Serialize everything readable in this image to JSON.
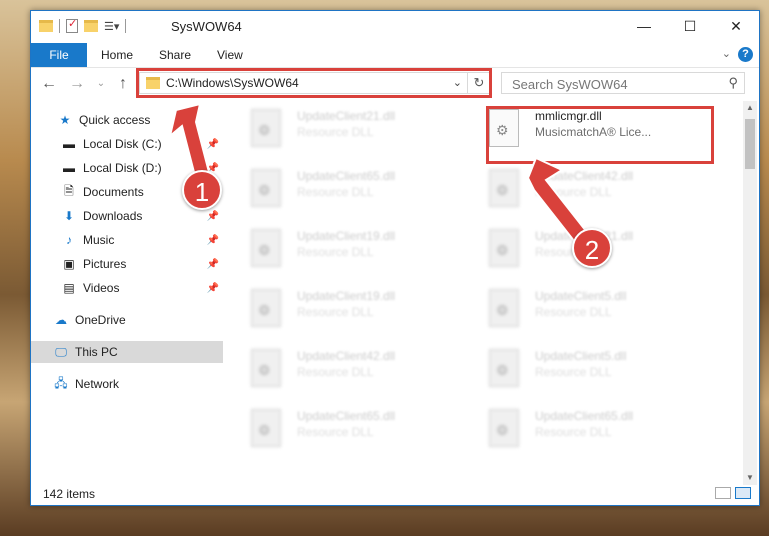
{
  "window": {
    "title": "SysWOW64"
  },
  "ribbon": {
    "tabs": [
      "File",
      "Home",
      "Share",
      "View"
    ]
  },
  "address": {
    "path": "C:\\Windows\\SysWOW64"
  },
  "search": {
    "placeholder": "Search SysWOW64"
  },
  "sidebar": {
    "items": [
      {
        "label": "Quick access",
        "icon": "star-icon",
        "pinned": false
      },
      {
        "label": "Local Disk (C:)",
        "icon": "drive-icon",
        "pinned": true
      },
      {
        "label": "Local Disk (D:)",
        "icon": "drive-icon",
        "pinned": true
      },
      {
        "label": "Documents",
        "icon": "documents-icon",
        "pinned": true
      },
      {
        "label": "Downloads",
        "icon": "download-icon",
        "pinned": true
      },
      {
        "label": "Music",
        "icon": "music-icon",
        "pinned": true
      },
      {
        "label": "Pictures",
        "icon": "pictures-icon",
        "pinned": true
      },
      {
        "label": "Videos",
        "icon": "videos-icon",
        "pinned": true
      },
      {
        "label": "OneDrive",
        "icon": "cloud-icon",
        "pinned": false
      },
      {
        "label": "This PC",
        "icon": "computer-icon",
        "pinned": false
      },
      {
        "label": "Network",
        "icon": "network-icon",
        "pinned": false
      }
    ]
  },
  "files": [
    {
      "name": "UpdateClient21.dll",
      "desc": "Resource DLL"
    },
    {
      "name": "mmlicmgr.dll",
      "desc": "MusicmatchA® Lice..."
    },
    {
      "name": "UpdateClient65.dll",
      "desc": "Resource DLL"
    },
    {
      "name": "UpdateClient42.dll",
      "desc": "Resource DLL"
    },
    {
      "name": "UpdateClient19.dll",
      "desc": "Resource DLL"
    },
    {
      "name": "UpdateClient21.dll",
      "desc": "Resource DLL"
    },
    {
      "name": "UpdateClient19.dll",
      "desc": "Resource DLL"
    },
    {
      "name": "UpdateClient5.dll",
      "desc": "Resource DLL"
    },
    {
      "name": "UpdateClient42.dll",
      "desc": "Resource DLL"
    },
    {
      "name": "UpdateClient5.dll",
      "desc": "Resource DLL"
    },
    {
      "name": "UpdateClient65.dll",
      "desc": "Resource DLL"
    },
    {
      "name": "UpdateClient65.dll",
      "desc": "Resource DLL"
    }
  ],
  "status": {
    "count": "142 items"
  },
  "annotations": {
    "step1": "1",
    "step2": "2"
  },
  "colors": {
    "accent": "#1979ca",
    "annotation": "#d9413b"
  }
}
